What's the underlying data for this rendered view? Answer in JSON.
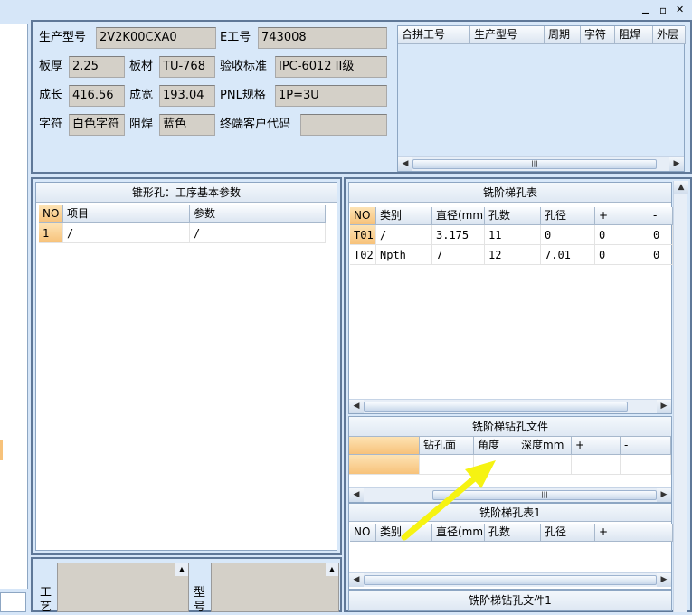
{
  "window": {
    "min_glyph": "▁",
    "restore_glyph": "▫",
    "close_glyph": "✕"
  },
  "info": {
    "prod_model_label": "生产型号",
    "prod_model": "2V2K00CXA0",
    "e_no_label": "E工号",
    "e_no": "743008",
    "thickness_label": "板厚",
    "thickness": "2.25",
    "material_label": "板材",
    "material": "TU-768",
    "accept_label": "验收标准",
    "accept": "IPC-6012 II级",
    "length_label": "成长",
    "length": "416.56",
    "width_label": "成宽",
    "width": "193.04",
    "pnl_label": "PNL规格",
    "pnl": "1P=3U",
    "char_label": "字符",
    "char": "白色字符",
    "mask_label": "阻焊",
    "mask": "蓝色",
    "customer_label": "终端客户代码",
    "customer": ""
  },
  "merge_table": {
    "headers": [
      "合拼工号",
      "生产型号",
      "周期",
      "字符",
      "阻焊",
      "外层"
    ]
  },
  "cone": {
    "title": "锥形孔：工序基本参数",
    "headers": [
      "NO",
      "项目",
      "参数"
    ],
    "rows": [
      [
        "1",
        "/",
        "/"
      ]
    ]
  },
  "mill": {
    "title": "铣阶梯孔表",
    "headers": [
      "NO",
      "类别",
      "直径(mm)",
      "孔数",
      "孔径",
      "+",
      "-"
    ],
    "rows": [
      [
        "T01",
        "/",
        "3.175",
        "11",
        "0",
        "0",
        "0"
      ],
      [
        "T02",
        "Npth",
        "7",
        "12",
        "7.01",
        "0",
        "0"
      ]
    ]
  },
  "drillfile": {
    "title": "铣阶梯钻孔文件",
    "headers": [
      "",
      "钻孔面",
      "角度",
      "深度mm",
      "+",
      "-"
    ]
  },
  "mill1": {
    "title": "铣阶梯孔表1",
    "headers": [
      "NO",
      "类别",
      "直径(mm)",
      "孔数",
      "孔径",
      "+"
    ]
  },
  "drillfile1": {
    "title": "铣阶梯钻孔文件1"
  },
  "bottom": {
    "proc_label": "工艺",
    "model_label": "型号"
  },
  "scroll": {
    "left": "◀",
    "right": "▶",
    "up": "▲",
    "down": "▼",
    "grip": "|||"
  }
}
